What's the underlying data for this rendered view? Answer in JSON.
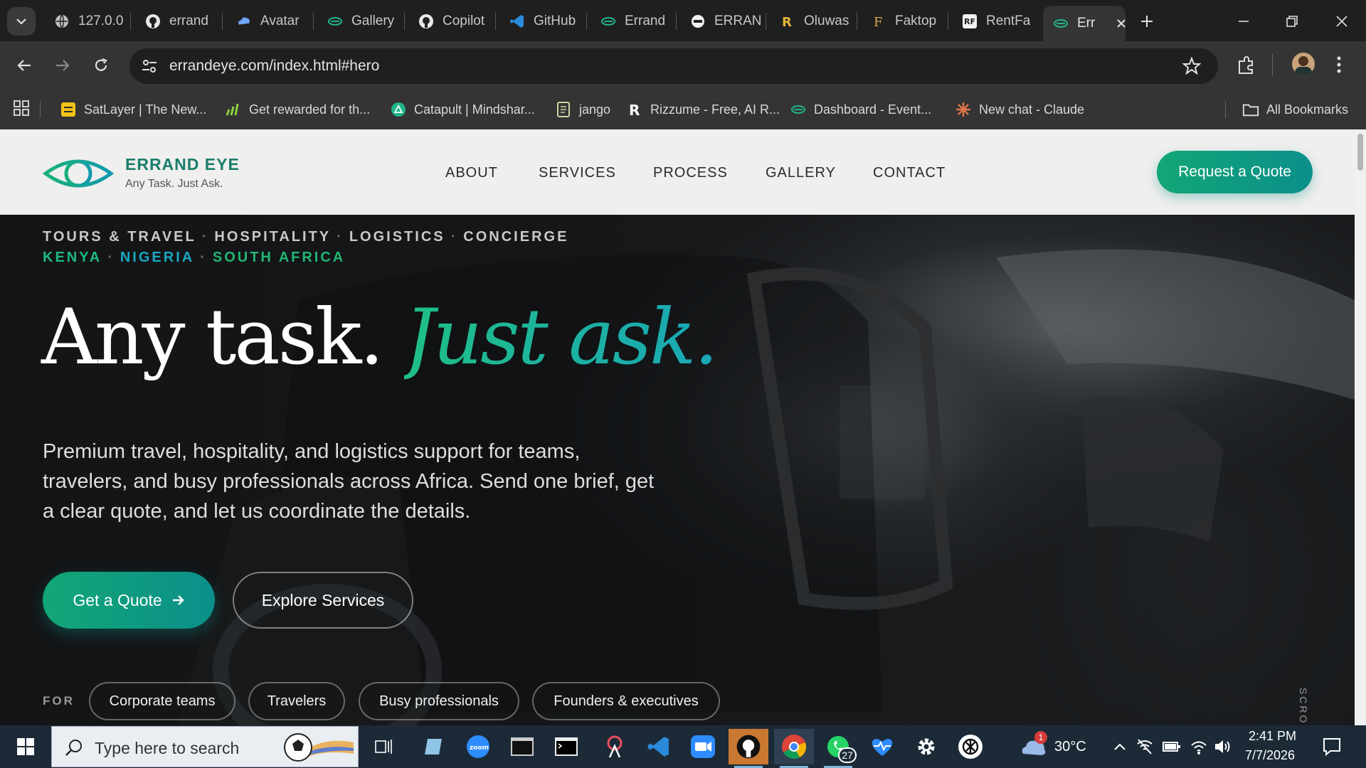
{
  "browser": {
    "tabs": [
      {
        "label": "127.0.0",
        "icon": "globe-icon"
      },
      {
        "label": "errand",
        "icon": "github-icon"
      },
      {
        "label": "Avatar",
        "icon": "cloud-icon"
      },
      {
        "label": "Gallery",
        "icon": "eye-logo-icon"
      },
      {
        "label": "Copilot",
        "icon": "github-icon"
      },
      {
        "label": "GitHub",
        "icon": "vscode-icon"
      },
      {
        "label": "Errand",
        "icon": "eye-logo-icon"
      },
      {
        "label": "ERRAN",
        "icon": "circle-logo-icon"
      },
      {
        "label": "Oluwas",
        "icon": "r-logo-icon"
      },
      {
        "label": "Faktop",
        "icon": "f-logo-icon"
      },
      {
        "label": "RentFa",
        "icon": "rentfa-icon"
      },
      {
        "label": "Err",
        "icon": "eye-logo-icon",
        "active": true
      }
    ],
    "url": "errandeye.com/index.html#hero",
    "bookmarks": [
      {
        "label": "SatLayer | The New...",
        "icon": "satlayer-icon"
      },
      {
        "label": "Get rewarded for th...",
        "icon": "chart-bars-icon"
      },
      {
        "label": "Catapult | Mindshar...",
        "icon": "catapult-icon"
      },
      {
        "label": "jango",
        "icon": "notepad-icon"
      },
      {
        "label": "Rizzume - Free, AI R...",
        "icon": "r-letter-icon"
      },
      {
        "label": "Dashboard - Event...",
        "icon": "eye-logo-icon"
      },
      {
        "label": "New chat - Claude",
        "icon": "claude-icon"
      }
    ],
    "all_bookmarks": "All Bookmarks"
  },
  "site": {
    "brand": "ERRAND EYE",
    "tagline": "Any Task. Just Ask.",
    "nav": [
      "ABOUT",
      "SERVICES",
      "PROCESS",
      "GALLERY",
      "CONTACT"
    ],
    "cta": "Request a Quote",
    "kicker_services": [
      "TOURS & TRAVEL",
      "HOSPITALITY",
      "LOGISTICS",
      "CONCIERGE"
    ],
    "kicker_countries": [
      "KENYA",
      "NIGERIA",
      "SOUTH AFRICA"
    ],
    "headline_main": "Any task.",
    "headline_accent": "Just ask.",
    "lead": "Premium travel, hospitality, and logistics support for teams, travelers, and busy professionals across Africa. Send one brief, get a clear quote, and let us coordinate the details.",
    "primary_button": "Get a Quote",
    "secondary_button": "Explore Services",
    "for_label": "FOR",
    "audiences": [
      "Corporate teams",
      "Travelers",
      "Busy professionals",
      "Founders & executives"
    ],
    "scroll_label": "SCRO",
    "colors": {
      "accent_green": "#12a676",
      "accent_teal": "#1aa7b7",
      "brand_text": "#1a7d6b"
    }
  },
  "taskbar": {
    "search_placeholder": "Type here to search",
    "whatsapp_badge": "27",
    "weather_badge": "1",
    "temperature": "30°C",
    "time": "2:41 PM",
    "date": "7/7/2026"
  }
}
